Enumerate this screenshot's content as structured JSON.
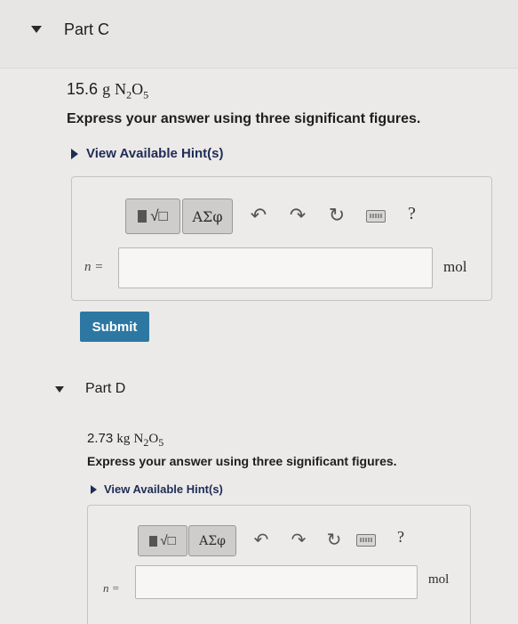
{
  "partC": {
    "title": "Part C",
    "mass": "15.6",
    "unit_mass": "g",
    "formula_N": "N",
    "formula_sub1": "2",
    "formula_O": "O",
    "formula_sub2": "5",
    "instruction": "Express your answer using three significant figures.",
    "hint": "View Available Hint(s)",
    "toolbar": {
      "templates_label": "√□",
      "symbols_label": "ΑΣφ",
      "help_label": "?"
    },
    "variable_label": "n =",
    "input_value": "",
    "unit": "mol",
    "submit_label": "Submit"
  },
  "partD": {
    "title": "Part D",
    "mass": "2.73",
    "unit_mass": "kg",
    "formula_N": "N",
    "formula_sub1": "2",
    "formula_O": "O",
    "formula_sub2": "5",
    "instruction": "Express your answer using three significant figures.",
    "hint": "View Available Hint(s)",
    "toolbar": {
      "templates_label": "√□",
      "symbols_label": "ΑΣφ",
      "help_label": "?"
    },
    "variable_label": "n =",
    "input_value": "",
    "unit": "mol"
  },
  "colors": {
    "submit": "#2d78a3",
    "hint_link": "#1f2c57"
  }
}
